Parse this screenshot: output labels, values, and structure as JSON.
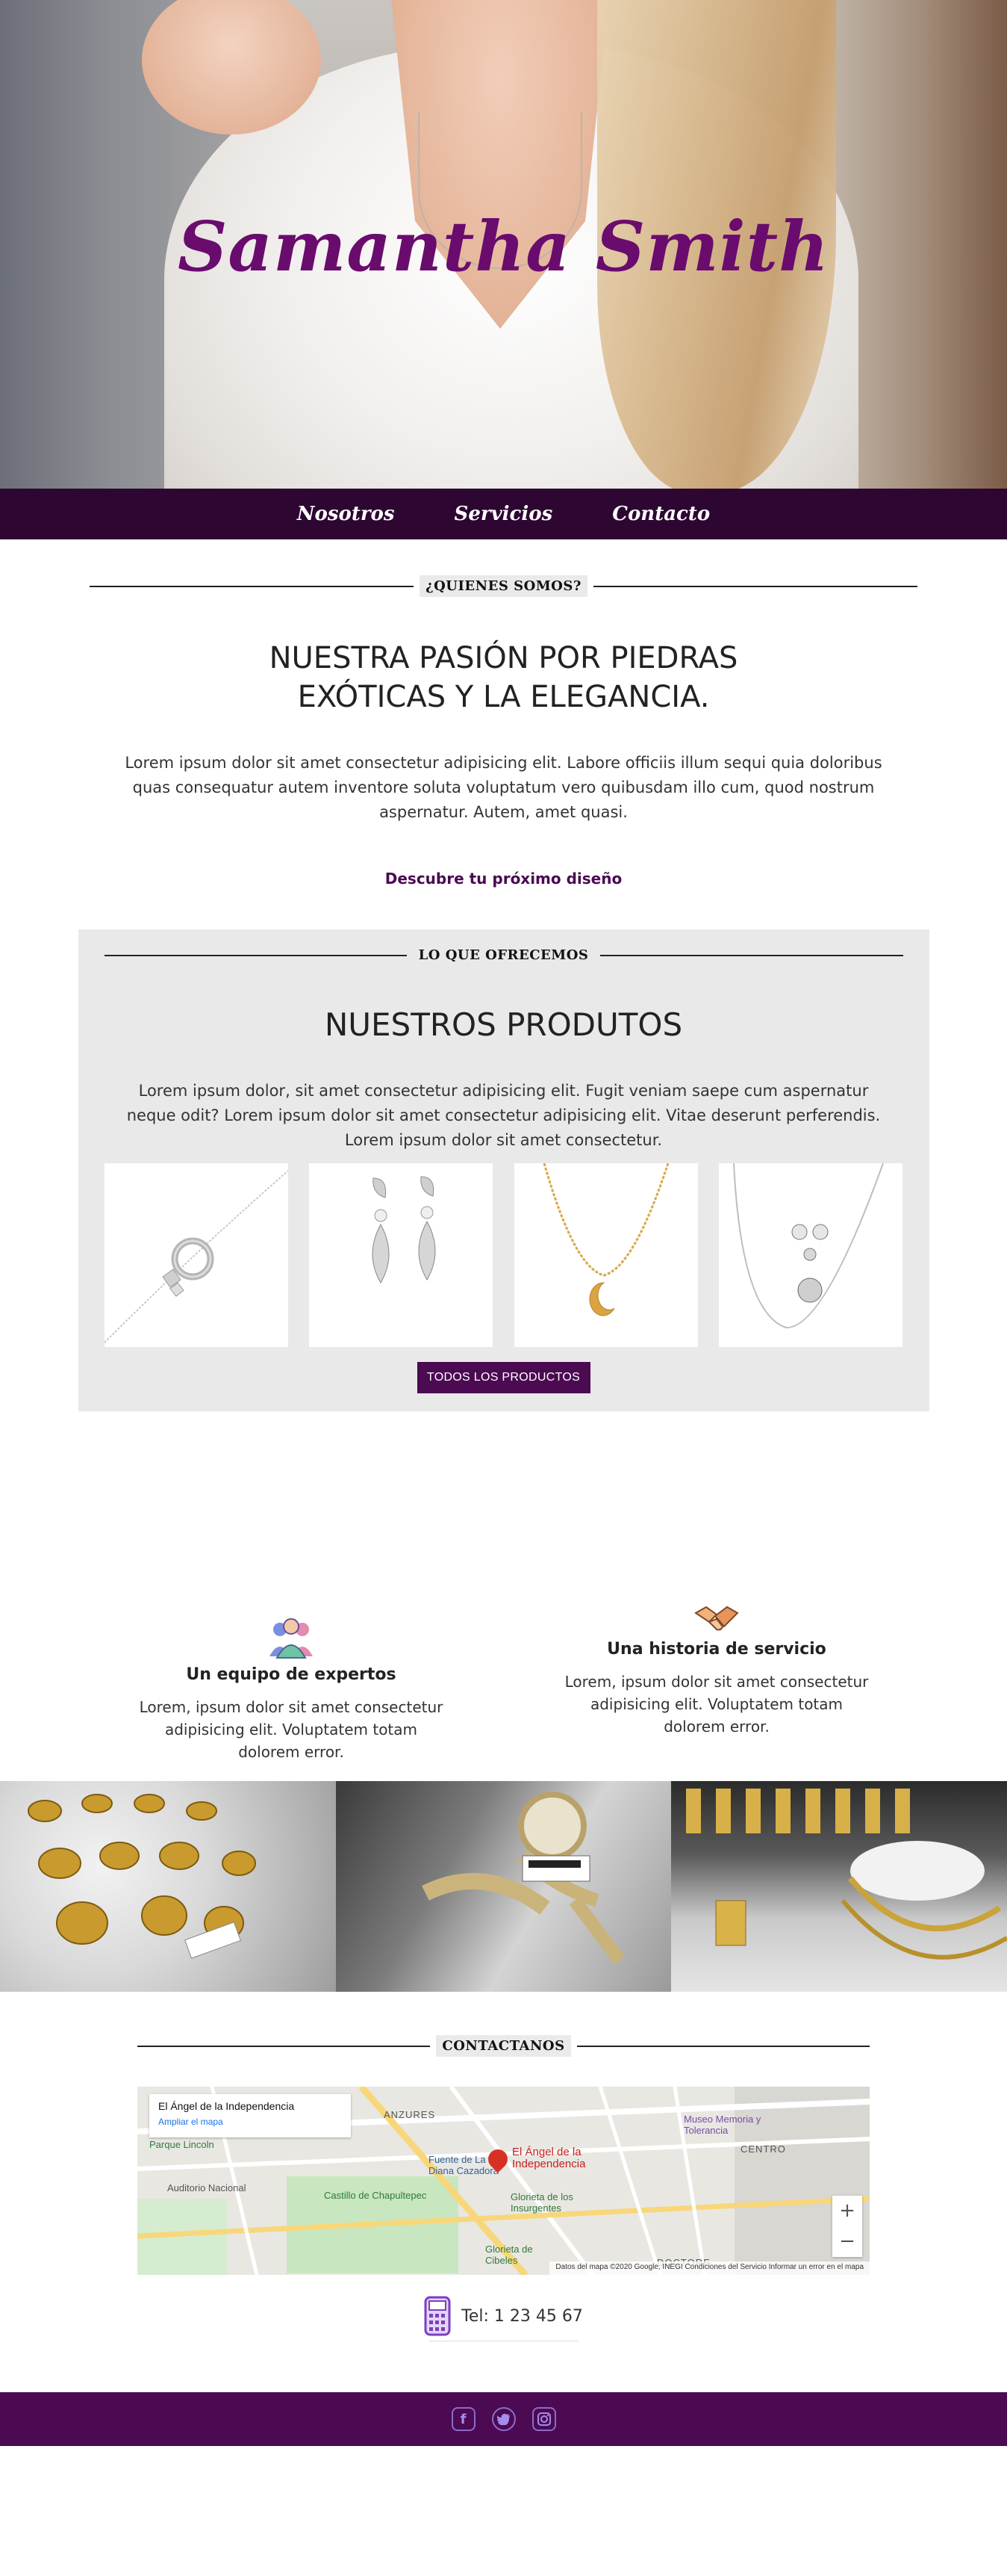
{
  "hero": {
    "title": "Samantha Smith"
  },
  "nav": {
    "items": [
      "Nosotros",
      "Servicios",
      "Contacto"
    ]
  },
  "about": {
    "kicker": "¿QUIENES SOMOS?",
    "title_line1": "NUESTRA PASIÓN POR PIEDRAS",
    "title_line2": "EXÓTICAS Y LA ELEGANCIA.",
    "text": "Lorem ipsum dolor sit amet consectetur adipisicing elit. Labore officiis illum sequi quia doloribus quas consequatur autem inventore soluta voluptatum vero quibusdam illo cum, quod nostrum aspernatur. Autem, amet quasi.",
    "cta": "Descubre tu próximo diseño"
  },
  "products": {
    "kicker": "LO QUE OFRECEMOS",
    "title": "NUESTROS PRODUTOS",
    "text": "Lorem ipsum dolor, sit amet consectetur adipisicing elit. Fugit veniam saepe cum aspernatur neque odit? Lorem ipsum dolor sit amet consectetur adipisicing elit. Vitae deserunt perferendis. Lorem ipsum dolor sit amet consectetur.",
    "items": [
      "bracelet",
      "earrings",
      "moon-necklace",
      "pendant-set"
    ],
    "button": "TODOS LOS PRODUCTOS"
  },
  "features": [
    {
      "title": "Un equipo de expertos",
      "text": "Lorem, ipsum dolor sit amet consectetur adipisicing elit. Voluptatem totam dolorem error.",
      "icon": "team-icon"
    },
    {
      "title": "Una historia de servicio",
      "text": "Lorem, ipsum dolor sit amet consectetur adipisicing elit. Voluptatem totam dolorem error.",
      "icon": "handshake-icon"
    }
  ],
  "contact": {
    "kicker": "CONTACTANOS",
    "map": {
      "place": "El Ángel de la Independencia",
      "link": "Ampliar el mapa",
      "pin_label_1": "El Ángel de la",
      "pin_label_2": "Independencia",
      "labels": [
        "ANZURES",
        "CENTRO",
        "DOCTORE",
        "Castillo de Chapultepec",
        "Parque Lincoln",
        "Glorieta de los Insurgentes",
        "Museo Memoria y Tolerancia",
        "Auditorio Nacional",
        "Fuente de La Diana Cazadora",
        "Glorieta de Cibeles"
      ],
      "credit": "Datos del mapa ©2020 Google, INEGI   Condiciones del Servicio   Informar un error en el mapa",
      "zoom_in": "+",
      "zoom_out": "−"
    },
    "phone": "Tel: 1 23 45 67"
  },
  "footer": {
    "icons": [
      "facebook-icon",
      "twitter-icon",
      "instagram-icon"
    ]
  },
  "colors": {
    "brand": "#4b0a52",
    "nav": "#2d0632",
    "hero_title": "#6a0b6e"
  }
}
